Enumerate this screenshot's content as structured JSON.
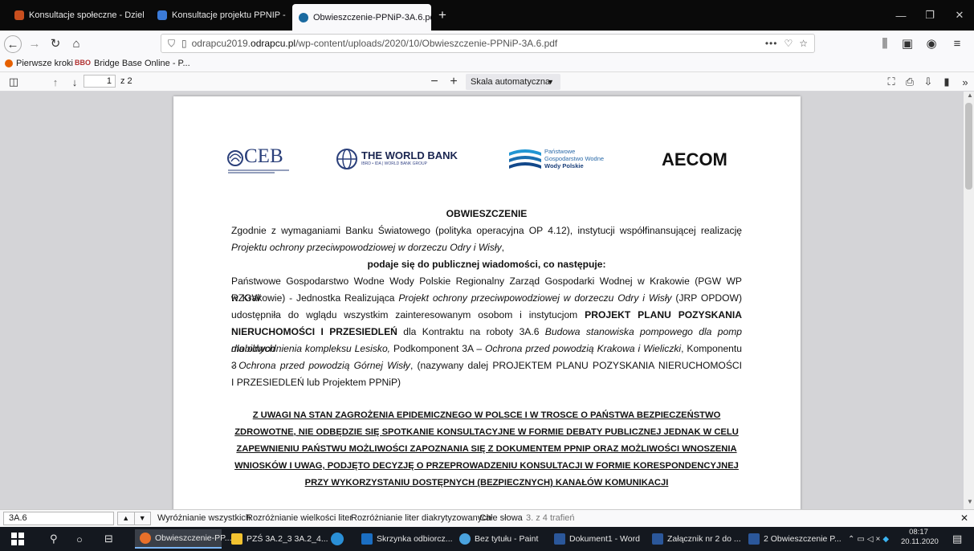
{
  "tabs": [
    {
      "label": "Konsultacje społeczne - Dzieln",
      "color": "#c84e1e"
    },
    {
      "label": "Konsultacje projektu PPNIP - K",
      "color": "#3b7bd9"
    },
    {
      "label": "Obwieszczenie-PPNiP-3A.6.pdf",
      "color": "#1a6aa0"
    }
  ],
  "url": {
    "prefix": "odrapcu2019.",
    "domain": "odrapcu.pl",
    "path": "/wp-content/uploads/2020/10/Obwieszczenie-PPNiP-3A.6.pdf"
  },
  "bookmarks": [
    {
      "label": "Pierwsze kroki"
    },
    {
      "label": "Bridge Base Online - P..."
    }
  ],
  "pdf_toolbar": {
    "page_current": "1",
    "page_total": "z 2",
    "zoom": "Skala automatyczna"
  },
  "logos": {
    "ceb": "CEB",
    "worldbank": "THE WORLD BANK",
    "worldbank_sub": "IBRD • IDA | WORLD BANK GROUP",
    "pgw_line1": "Państwowe",
    "pgw_line2": "Gospodarstwo Wodne",
    "pgw_line3": "Wody Polskie",
    "aecom": "AECOM"
  },
  "document": {
    "title": "OBWIESZCZENIE",
    "p1_l1": "Zgodnie z wymaganiami Banku Światowego (polityka operacyjna OP 4.12), instytucji współfinansującej realizację",
    "p1_l2": "Projektu ochrony przeciwpowodziowej w dorzeczu Odry i Wisły",
    "p1_l2_tail": ",",
    "announce": "podaje się do publicznej wiadomości, co następuje:",
    "p2_l1": "Państwowe Gospodarstwo Wodne Wody Polskie Regionalny Zarząd Gospodarki Wodnej w Krakowie (PGW WP RZGW",
    "p2_l2a": "w Krakowie) - Jednostka Realizująca ",
    "p2_l2b": "Projekt ochrony przeciwpowodziowej w dorzeczu Odry i Wisły",
    "p2_l2c": " (JRP OPDOW)",
    "p2_l3a": "udostępniła do wglądu wszystkim zainteresowanym osobom i instytucjom ",
    "p2_l3b": "PROJEKT PLANU POZYSKANIA",
    "p2_l4a": "NIERUCHOMOŚCI I PRZESIEDLEŃ",
    "p2_l4b": " dla Kontraktu na roboty 3A.6 ",
    "p2_l4c": "Budowa stanowiska pompowego dla pomp mobilnych",
    "p2_l5a": "dla odwodnienia kompleksu Lesisko,",
    "p2_l5b": " Podkomponent 3A – ",
    "p2_l5c": "Ochrona przed powodzią Krakowa i Wieliczki",
    "p2_l5d": ", Komponentu 3",
    "p2_l6a": "- ",
    "p2_l6b": "Ochrona przed powodzią Górnej Wisły",
    "p2_l6c": ", (nazywany dalej PROJEKTEM PLANU POZYSKANIA NIERUCHOMOŚCI",
    "p2_l7": "I PRZESIEDLEŃ lub Projektem PPNiP)",
    "n1": "Z UWAGI NA STAN ZAGROŻENIA EPIDEMICZNEGO W POLSCE I W TROSCE O PAŃSTWA BEZPIECZEŃSTWO",
    "n2": "ZDROWOTNE, NIE ODBĘDZIE SIĘ SPOTKANIE KONSULTACYJNE W FORMIE DEBATY PUBLICZNEJ JEDNAK W CELU",
    "n3": "ZAPEWNIENIU PAŃSTWU MOŻLIWOŚCI ZAPOZNANIA SIĘ Z DOKUMENTEM PPNIP ORAZ MOŻLIWOŚCI WNOSZENIA",
    "n4": "WNIOSKÓW I UWAG, PODJĘTO DECYZJĘ O PRZEPROWADZENIU KONSULTACJI W FORMIE KORESPONDENCYJNEJ",
    "n5": "PRZY WYKORZYSTANIU DOSTĘPNYCH (BEZPIECZNYCH) KANAŁÓW KOMUNIKACJI"
  },
  "findbar": {
    "query": "3A.6",
    "highlight_all": "Wyróżnianie wszystkich",
    "match_case": "Rozróżnianie wielkości liter",
    "match_diacritics": "Rozróżnianie liter diakrytyzowanych",
    "whole_words": "Całe słowa",
    "result": "3. z 4 trafień"
  },
  "taskbar": {
    "items": [
      {
        "label": "Obwieszczenie-PP...",
        "color": "#e8702a"
      },
      {
        "label": "PZŚ 3A.2_3 3A.2_4...",
        "color": "#f2c230"
      },
      {
        "label": "",
        "color": "#2a8fd6"
      },
      {
        "label": "Skrzynka odbiorcz...",
        "color": "#1b6ec2"
      },
      {
        "label": "Bez tytułu - Paint",
        "color": "#4aa3df"
      },
      {
        "label": "Dokument1 - Word",
        "color": "#2b579a"
      },
      {
        "label": "Załącznik nr 2 do ...",
        "color": "#2b579a"
      },
      {
        "label": "2 Obwieszczenie P...",
        "color": "#2b579a"
      }
    ],
    "time": "08:17",
    "date": "20.11.2020"
  }
}
